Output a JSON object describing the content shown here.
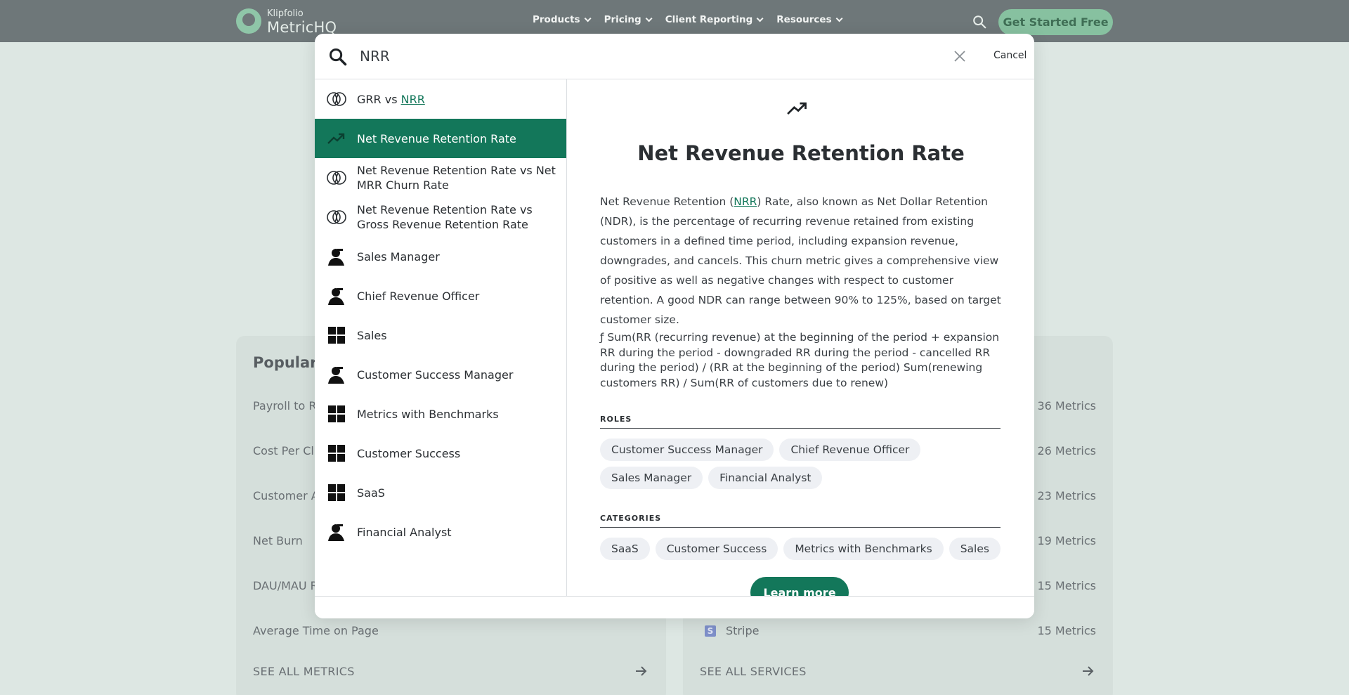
{
  "colors": {
    "brand_green": "#13775a",
    "nav_bg": "#6e7779",
    "page_bg": "#dde7e3",
    "cta_bg": "#87c1a0"
  },
  "header": {
    "logo_small": "Klipfolio",
    "logo_big": "MetricHQ",
    "nav": [
      "Products",
      "Pricing",
      "Client Reporting",
      "Resources"
    ],
    "cta": "Get Started Free"
  },
  "background": {
    "left": {
      "title": "Popular m",
      "rows": [
        "Payroll to Re",
        "Cost Per Cli",
        "Customer A",
        "Net Burn",
        "DAU/MAU R",
        "Average Time on Page"
      ],
      "footer": "SEE ALL METRICS"
    },
    "right": {
      "counts": [
        "36 Metrics",
        "26 Metrics",
        "23 Metrics",
        "19 Metrics",
        "15 Metrics",
        "15 Metrics"
      ],
      "last_row": "Stripe",
      "stripe_glyph": "S",
      "footer": "SEE ALL SERVICES"
    }
  },
  "search": {
    "query": "NRR",
    "cancel": "Cancel"
  },
  "results": [
    {
      "icon": "compare-icon",
      "pre": "GRR vs ",
      "match": "NRR",
      "post": "",
      "active": false
    },
    {
      "icon": "trend-icon",
      "label": "Net Revenue Retention Rate",
      "active": true
    },
    {
      "icon": "compare-icon",
      "label": "Net Revenue Retention Rate vs Net MRR Churn Rate",
      "active": false
    },
    {
      "icon": "compare-icon",
      "label": "Net Revenue Retention Rate vs Gross Revenue Retention Rate",
      "active": false
    },
    {
      "icon": "person-icon",
      "label": "Sales Manager",
      "active": false
    },
    {
      "icon": "person-icon",
      "label": "Chief Revenue Officer",
      "active": false
    },
    {
      "icon": "grid-icon",
      "label": "Sales",
      "active": false
    },
    {
      "icon": "person-icon",
      "label": "Customer Success Manager",
      "active": false
    },
    {
      "icon": "grid-icon",
      "label": "Metrics with Benchmarks",
      "active": false
    },
    {
      "icon": "grid-icon",
      "label": "Customer Success",
      "active": false
    },
    {
      "icon": "grid-icon",
      "label": "SaaS",
      "active": false
    },
    {
      "icon": "person-icon",
      "label": "Financial Analyst",
      "active": false
    }
  ],
  "detail": {
    "icon": "trend-icon",
    "title": "Net Revenue Retention Rate",
    "desc_pre": "Net Revenue Retention (",
    "desc_match": "NRR",
    "desc_post": ") Rate, also known as Net Dollar Retention (NDR), is the percentage of recurring revenue retained from existing customers in a defined time period, including expansion revenue, downgrades, and cancels. This churn metric gives a comprehensive view of positive as well as negative changes with respect to customer retention. A good NDR can range between 90% to 125%, based on target customer size.",
    "formula": "ƒ Sum(RR (recurring revenue) at the beginning of the period + expansion RR during the period - downgraded RR during the period - cancelled RR during the period) / (RR at the beginning of the period) Sum(renewing customers RR) / Sum(RR of customers due to renew)",
    "roles_heading": "ROLES",
    "roles": [
      "Customer Success Manager",
      "Chief Revenue Officer",
      "Sales Manager",
      "Financial Analyst"
    ],
    "categories_heading": "CATEGORIES",
    "categories": [
      "SaaS",
      "Customer Success",
      "Metrics with Benchmarks",
      "Sales"
    ],
    "learn_more": "Learn more"
  }
}
